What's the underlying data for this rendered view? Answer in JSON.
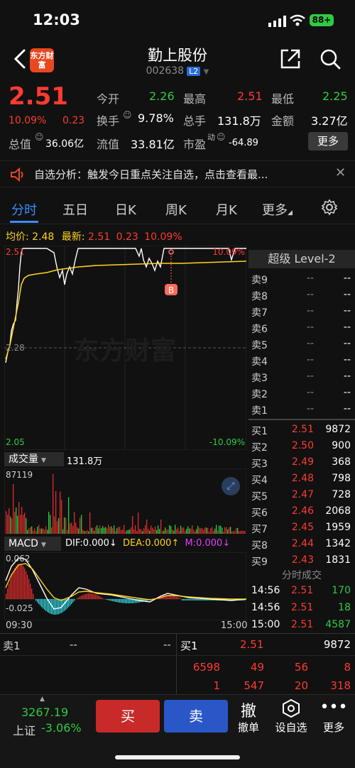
{
  "status": {
    "time": "12:03",
    "battery": "88+"
  },
  "header": {
    "logo": "东方财富",
    "name": "勤上股份",
    "code": "002638",
    "level": "L2"
  },
  "quote": {
    "price": "2.51",
    "change_pct": "10.09%",
    "change": "0.23",
    "open_label": "今开",
    "open": "2.26",
    "high_label": "最高",
    "high": "2.51",
    "low_label": "最低",
    "low": "2.25",
    "turnover_label": "换手",
    "turnover": "9.78%",
    "volume_label": "总手",
    "volume": "131.8万",
    "amount_label": "金额",
    "amount": "3.27亿",
    "mktcap_label": "总值",
    "mktcap": "36.06亿",
    "float_label": "流值",
    "float": "33.81亿",
    "pe_label": "市盈",
    "pe_sup": "动",
    "pe": "-64.89",
    "more": "更多"
  },
  "alert": {
    "text": "自选分析：触发今日重点关注自选，点击查看最..."
  },
  "tabs": {
    "t1": "分时",
    "t2": "五日",
    "t3": "日K",
    "t4": "周K",
    "t5": "月K",
    "t6": "更多"
  },
  "info": {
    "avg_label": "均价:",
    "avg": "2.48",
    "latest_label": "最新:",
    "latest": "2.51",
    "chg": "0.23",
    "pct": "10.09%"
  },
  "chart": {
    "top_price": "2.51",
    "mid_price": "2.28",
    "bottom_price": "2.05",
    "top_pct": "10.09%",
    "bottom_pct": "-10.09%",
    "watermark": "东方财富",
    "marker": "B",
    "start_time": "09:30",
    "end_time": "15:00"
  },
  "volume": {
    "selector": "成交量",
    "total": "131.8万",
    "max": "87119"
  },
  "macd": {
    "selector": "MACD",
    "dif": "DIF:0.000",
    "dea": "DEA:0.000",
    "m": "M:0.000",
    "top": "0.062",
    "bottom": "-0.025"
  },
  "book": {
    "title": "超级 Level-2",
    "asks": [
      {
        "n": "卖9",
        "p": "--",
        "v": "--"
      },
      {
        "n": "卖8",
        "p": "--",
        "v": "--"
      },
      {
        "n": "卖7",
        "p": "--",
        "v": "--"
      },
      {
        "n": "卖6",
        "p": "--",
        "v": "--"
      },
      {
        "n": "卖5",
        "p": "--",
        "v": "--"
      },
      {
        "n": "卖4",
        "p": "--",
        "v": "--"
      },
      {
        "n": "卖3",
        "p": "--",
        "v": "--"
      },
      {
        "n": "卖2",
        "p": "--",
        "v": "--"
      },
      {
        "n": "卖1",
        "p": "--",
        "v": "--"
      }
    ],
    "bids": [
      {
        "n": "买1",
        "p": "2.51",
        "v": "9872"
      },
      {
        "n": "买2",
        "p": "2.50",
        "v": "900"
      },
      {
        "n": "买3",
        "p": "2.49",
        "v": "368"
      },
      {
        "n": "买4",
        "p": "2.48",
        "v": "798"
      },
      {
        "n": "买5",
        "p": "2.47",
        "v": "728"
      },
      {
        "n": "买6",
        "p": "2.46",
        "v": "2068"
      },
      {
        "n": "买7",
        "p": "2.45",
        "v": "1959"
      },
      {
        "n": "买8",
        "p": "2.44",
        "v": "1342"
      },
      {
        "n": "买9",
        "p": "2.43",
        "v": "1831"
      }
    ]
  },
  "trades": {
    "title": "分时成交",
    "rows": [
      {
        "t": "14:56",
        "p": "2.51",
        "v": "170"
      },
      {
        "t": "14:56",
        "p": "2.51",
        "v": "18"
      },
      {
        "t": "15:00",
        "p": "2.51",
        "v": "4587"
      }
    ]
  },
  "l2": {
    "sell_label": "卖1",
    "sell_a": "--",
    "sell_b": "--",
    "buy_label": "买1",
    "buy_price": "2.51",
    "buy_vol": "9872",
    "q1": "6598",
    "q2": "49",
    "q3": "56",
    "q4": "8",
    "q5": "1",
    "q6": "547",
    "q7": "20",
    "q8": "318"
  },
  "bottom": {
    "index_value": "3267.19",
    "index_name": "上证",
    "index_chg": "-3.06%",
    "buy": "买",
    "sell": "卖",
    "cancel_icon": "撤",
    "cancel": "撤单",
    "watch": "设自选",
    "more": "更多"
  },
  "colors": {
    "up": "#ff3b30",
    "down": "#2ecc40",
    "accent": "#3d8bff",
    "avg_line": "#ffd21f"
  }
}
